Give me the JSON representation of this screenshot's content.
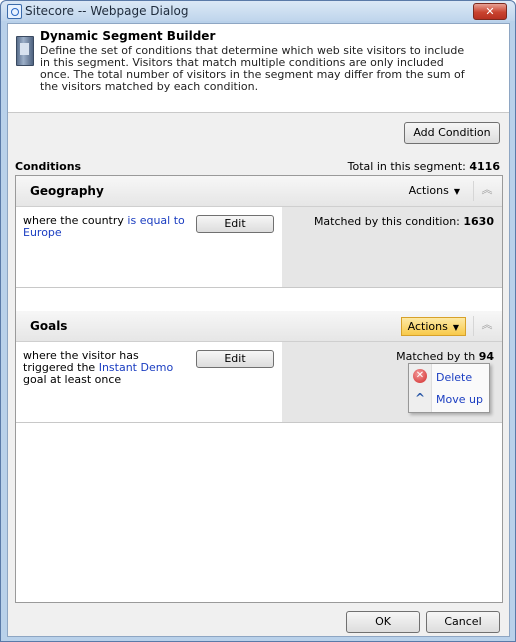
{
  "window": {
    "title": "Sitecore -- Webpage Dialog",
    "close_label": "✕"
  },
  "header": {
    "title": "Dynamic Segment Builder",
    "description": "Define the set of conditions that determine which web site visitors to include in this segment. Visitors that match multiple conditions are only included once. The total number of visitors in the segment may differ from the sum of the visitors matched by each condition."
  },
  "toolbar": {
    "add_condition_label": "Add Condition"
  },
  "conditions": {
    "heading": "Conditions",
    "total_label": "Total in this segment:",
    "total_value": "4116",
    "items": [
      {
        "title": "Geography",
        "actions_label": "Actions",
        "rule_prefix": "where the country ",
        "rule_link": "is equal to Europe",
        "rule_suffix": "",
        "edit_label": "Edit",
        "matched_label": "Matched by this condition:",
        "matched_value": "1630"
      },
      {
        "title": "Goals",
        "actions_label": "Actions",
        "rule_prefix": "where the visitor has triggered the ",
        "rule_link": "Instant Demo",
        "rule_suffix": " goal at least once",
        "edit_label": "Edit",
        "matched_label": "Matched by th",
        "matched_value": "94"
      }
    ]
  },
  "actions_menu": {
    "items": [
      {
        "label": "Delete",
        "icon": "delete-icon"
      },
      {
        "label": "Move up",
        "icon": "move-up-icon"
      }
    ]
  },
  "footer": {
    "ok_label": "OK",
    "cancel_label": "Cancel"
  },
  "colors": {
    "link": "#1a3dc1",
    "active_actions": "#f8c94a",
    "title_close": "#c9432f"
  }
}
